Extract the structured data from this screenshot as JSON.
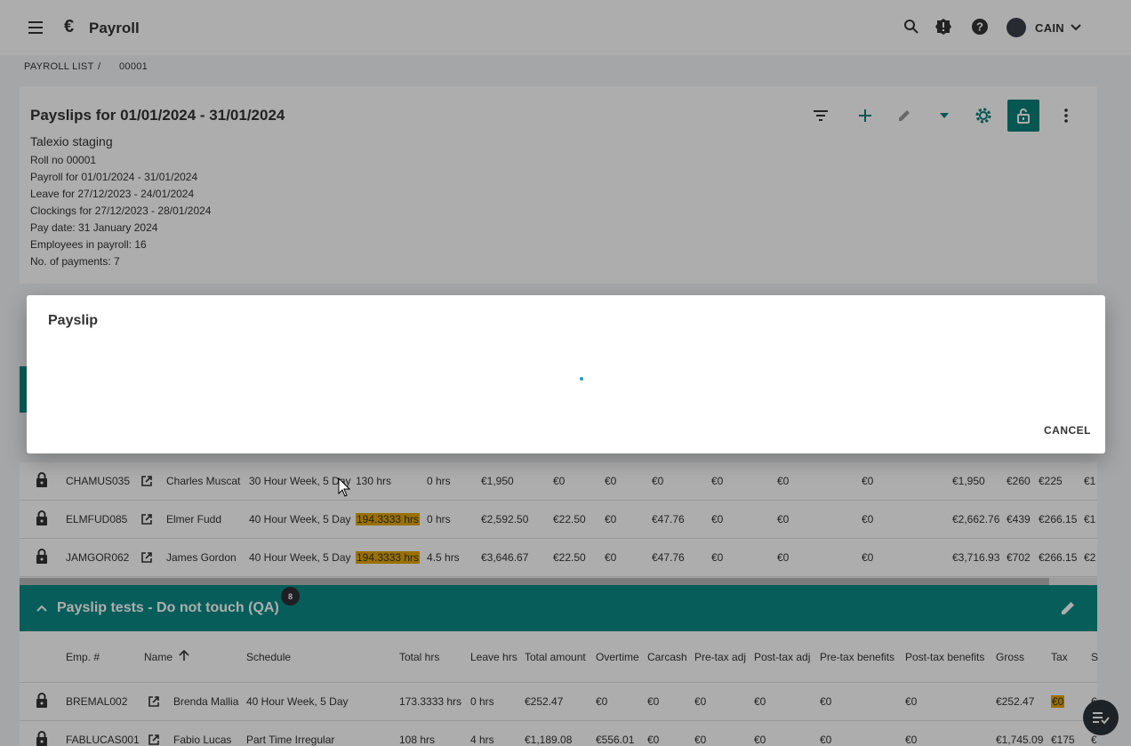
{
  "app": {
    "currency_symbol": "€",
    "title": "Payroll"
  },
  "header": {
    "user_name": "CAIN"
  },
  "breadcrumb": {
    "root": "PAYROLL LIST",
    "separator": "/",
    "current": "00001"
  },
  "card": {
    "title": "Payslips for 01/01/2024 - 31/01/2024",
    "company": "Talexio staging",
    "lines": [
      "Roll no 00001",
      "Payroll for 01/01/2024 - 31/01/2024",
      "Leave for 27/12/2023 - 24/01/2024",
      "Clockings for 27/12/2023 - 28/01/2024",
      "Pay date: 31 January 2024",
      "Employees in payroll: 16",
      "No. of payments: 7"
    ]
  },
  "group1_rows": [
    {
      "emp": "CHAMUS035",
      "name": "Charles Muscat",
      "schedule": "30 Hour Week, 5 Day",
      "total_hrs": "130 hrs",
      "total_hl": false,
      "leave_hrs": "0 hrs",
      "total_amount": "€1,950",
      "overtime": "€0",
      "carcash": "€0",
      "pretax_adj": "€0",
      "posttax_adj": "€0",
      "pretax_ben": "€0",
      "posttax_ben": "€0",
      "gross": "€1,950",
      "tax": "€260",
      "ssc": "€225",
      "extra": "€1"
    },
    {
      "emp": "ELMFUD085",
      "name": "Elmer Fudd",
      "schedule": "40 Hour Week, 5 Day",
      "total_hrs": "194.3333 hrs",
      "total_hl": true,
      "leave_hrs": "0 hrs",
      "total_amount": "€2,592.50",
      "overtime": "€22.50",
      "carcash": "€0",
      "pretax_adj": "€47.76",
      "posttax_adj": "€0",
      "pretax_ben": "€0",
      "posttax_ben": "€0",
      "gross": "€2,662.76",
      "tax": "€439",
      "ssc": "€266.15",
      "extra": "€1"
    },
    {
      "emp": "JAMGOR062",
      "name": "James Gordon",
      "schedule": "40 Hour Week, 5 Day",
      "total_hrs": "194.3333 hrs",
      "total_hl": true,
      "leave_hrs": "4.5 hrs",
      "total_amount": "€3,646.67",
      "overtime": "€22.50",
      "carcash": "€0",
      "pretax_adj": "€47.76",
      "posttax_adj": "€0",
      "pretax_ben": "€0",
      "posttax_ben": "€0",
      "gross": "€3,716.93",
      "tax": "€702",
      "ssc": "€266.15",
      "extra": "€2"
    }
  ],
  "group2": {
    "title": "Payslip tests - Do not touch (QA)",
    "badge": "8",
    "columns": {
      "emp": "Emp. #",
      "name": "Name",
      "schedule": "Schedule",
      "total_hrs": "Total hrs",
      "leave_hrs": "Leave hrs",
      "total_amount": "Total amount",
      "overtime": "Overtime",
      "carcash": "Carcash",
      "pretax_adj": "Pre-tax adj",
      "posttax_adj": "Post-tax adj",
      "pretax_ben": "Pre-tax benefits",
      "posttax_ben": "Post-tax benefits",
      "gross": "Gross",
      "tax": "Tax",
      "ssc": "S"
    },
    "rows": [
      {
        "emp": "BREMAL002",
        "name": "Brenda Mallia",
        "schedule": "40 Hour Week, 5 Day",
        "total_hrs": "173.3333 hrs",
        "leave_hrs": "0 hrs",
        "total_amount": "€252.47",
        "overtime": "€0",
        "carcash": "€0",
        "pretax_adj": "€0",
        "posttax_adj": "€0",
        "pretax_ben": "€0",
        "posttax_ben": "€0",
        "gross": "€252.47",
        "tax": "€0",
        "tax_hl": true,
        "extra": "€"
      },
      {
        "emp": "FABLUCAS001",
        "name": "Fabio Lucas",
        "schedule": "Part Time Irregular",
        "total_hrs": "108 hrs",
        "leave_hrs": "4 hrs",
        "total_amount": "€1,189.08",
        "overtime": "€556.01",
        "carcash": "€0",
        "pretax_adj": "€0",
        "posttax_adj": "€0",
        "pretax_ben": "€0",
        "posttax_ben": "€0",
        "gross": "€1,745.09",
        "tax": "€175",
        "tax_hl": false,
        "extra": "€"
      }
    ]
  },
  "dialog": {
    "title": "Payslip",
    "cancel_label": "CANCEL"
  },
  "colors": {
    "teal": "#0b8a85",
    "highlight": "#e3a700",
    "spinner": "#1b9bd1"
  }
}
